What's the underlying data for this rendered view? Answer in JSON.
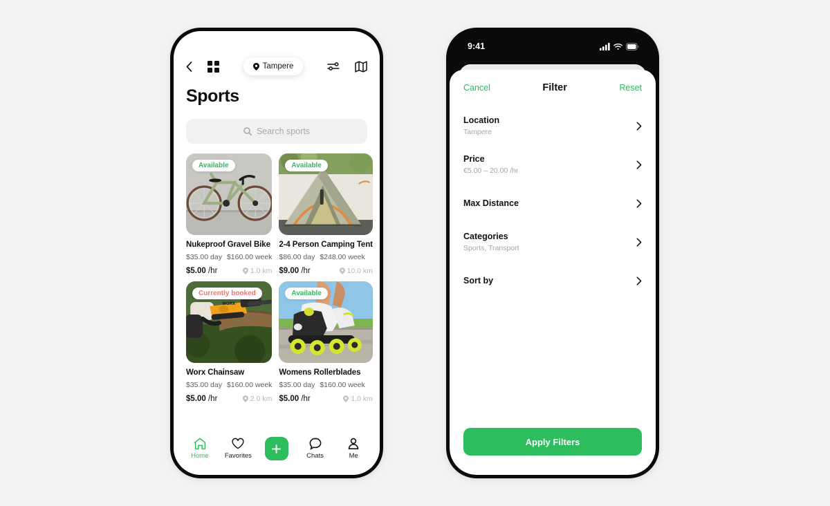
{
  "theme": {
    "background": "#f3f3f1",
    "accent_green": "#2EBD5C",
    "booked_red": "#F0796D",
    "text_dark": "#111111",
    "text_muted": "#a5a5a5"
  },
  "browse_screen": {
    "header": {
      "back_icon": "chevron-left-icon",
      "grid_icon": "grid-view-icon",
      "location_pill": {
        "pin_icon": "map-pin-icon",
        "label": "Tampere"
      },
      "filter_icon": "sliders-filter-icon",
      "map_icon": "folded-map-icon"
    },
    "title": "Sports",
    "search": {
      "icon": "search-icon",
      "placeholder": "Search sports"
    },
    "listings": [
      {
        "name": "Nukeproof Gravel Bike",
        "status": "Available",
        "status_type": "available",
        "day_rate": "$35.00 day",
        "week_rate": "$160.00 week",
        "hourly_price": "$5.00",
        "hourly_unit": "/hr",
        "distance": "1.0 km",
        "image": "gravel-bike-photo"
      },
      {
        "name": "2-4 Person Camping Tent",
        "status": "Available",
        "status_type": "available",
        "day_rate": "$86.00 day",
        "week_rate": "$248.00 week",
        "hourly_price": "$9.00",
        "hourly_unit": "/hr",
        "distance": "10.0 km",
        "image": "camping-tent-photo"
      },
      {
        "name": "Worx Chainsaw",
        "status": "Currently booked",
        "status_type": "booked",
        "day_rate": "$35.00 day",
        "week_rate": "$160.00 week",
        "hourly_price": "$5.00",
        "hourly_unit": "/hr",
        "distance": "2.0 km",
        "image": "chainsaw-photo"
      },
      {
        "name": "Womens Rollerblades",
        "status": "Available",
        "status_type": "available",
        "day_rate": "$35.00 day",
        "week_rate": "$160.00 week",
        "hourly_price": "$5.00",
        "hourly_unit": "/hr",
        "distance": "1.0 km",
        "image": "rollerblades-photo"
      }
    ],
    "tabbar": {
      "items": [
        {
          "label": "Home",
          "icon": "home-icon",
          "active": true
        },
        {
          "label": "Favorites",
          "icon": "heart-icon",
          "active": false
        },
        {
          "label": "Chats",
          "icon": "chat-bubble-icon",
          "active": false
        },
        {
          "label": "Me",
          "icon": "person-icon",
          "active": false
        }
      ],
      "fab": {
        "icon": "plus-icon"
      }
    }
  },
  "filter_screen": {
    "statusbar": {
      "time": "9:41",
      "icons": [
        "cellular-signal-icon",
        "wifi-icon",
        "battery-icon"
      ]
    },
    "sheet": {
      "cancel_label": "Cancel",
      "title": "Filter",
      "reset_label": "Reset",
      "rows": [
        {
          "label": "Location",
          "value": "Tampere",
          "chevron": "chevron-right-icon"
        },
        {
          "label": "Price",
          "value": "€5.00 – 20.00 /hr",
          "chevron": "chevron-right-icon"
        },
        {
          "label": "Max Distance",
          "value": "",
          "chevron": "chevron-right-icon"
        },
        {
          "label": "Categories",
          "value": "Sports, Transport",
          "chevron": "chevron-right-icon"
        },
        {
          "label": "Sort by",
          "value": "",
          "chevron": "chevron-right-icon"
        }
      ],
      "apply_label": "Apply Filters"
    }
  }
}
